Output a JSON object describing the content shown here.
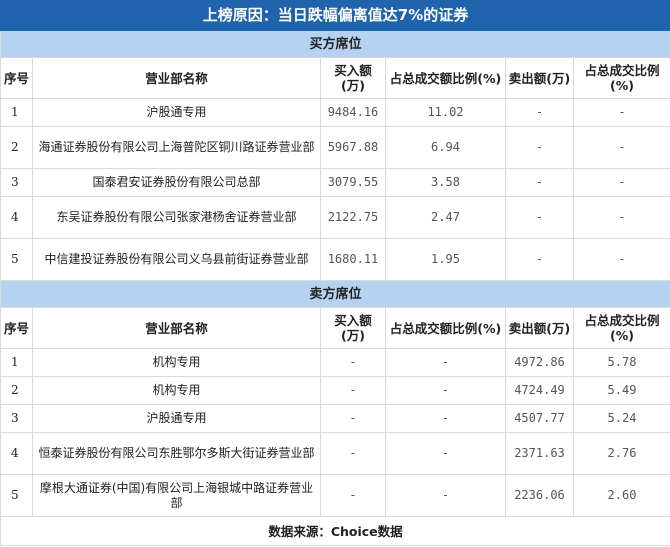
{
  "title": "上榜原因：当日跌幅偏离值达7%的证券",
  "headers": [
    "序号",
    "营业部名称",
    "买入额(万)",
    "占总成交额比例(%)",
    "卖出额(万)",
    "占总成交比例(%)"
  ],
  "buy": {
    "label": "买方席位",
    "rows": [
      [
        "1",
        "沪股通专用",
        "9484.16",
        "11.02",
        "-",
        "-"
      ],
      [
        "2",
        "海通证券股份有限公司上海普陀区铜川路证券营业部",
        "5967.88",
        "6.94",
        "-",
        "-"
      ],
      [
        "3",
        "国泰君安证券股份有限公司总部",
        "3079.55",
        "3.58",
        "-",
        "-"
      ],
      [
        "4",
        "东吴证券股份有限公司张家港杨舍证券营业部",
        "2122.75",
        "2.47",
        "-",
        "-"
      ],
      [
        "5",
        "中信建投证券股份有限公司义乌县前街证券营业部",
        "1680.11",
        "1.95",
        "-",
        "-"
      ]
    ]
  },
  "sell": {
    "label": "卖方席位",
    "rows": [
      [
        "1",
        "机构专用",
        "-",
        "-",
        "4972.86",
        "5.78"
      ],
      [
        "2",
        "机构专用",
        "-",
        "-",
        "4724.49",
        "5.49"
      ],
      [
        "3",
        "沪股通专用",
        "-",
        "-",
        "4507.77",
        "5.24"
      ],
      [
        "4",
        "恒泰证券股份有限公司东胜鄂尔多斯大街证券营业部",
        "-",
        "-",
        "2371.63",
        "2.76"
      ],
      [
        "5",
        "摩根大通证券(中国)有限公司上海银城中路证券营业部",
        "-",
        "-",
        "2236.06",
        "2.60"
      ]
    ]
  },
  "footer": "数据来源：Choice数据"
}
